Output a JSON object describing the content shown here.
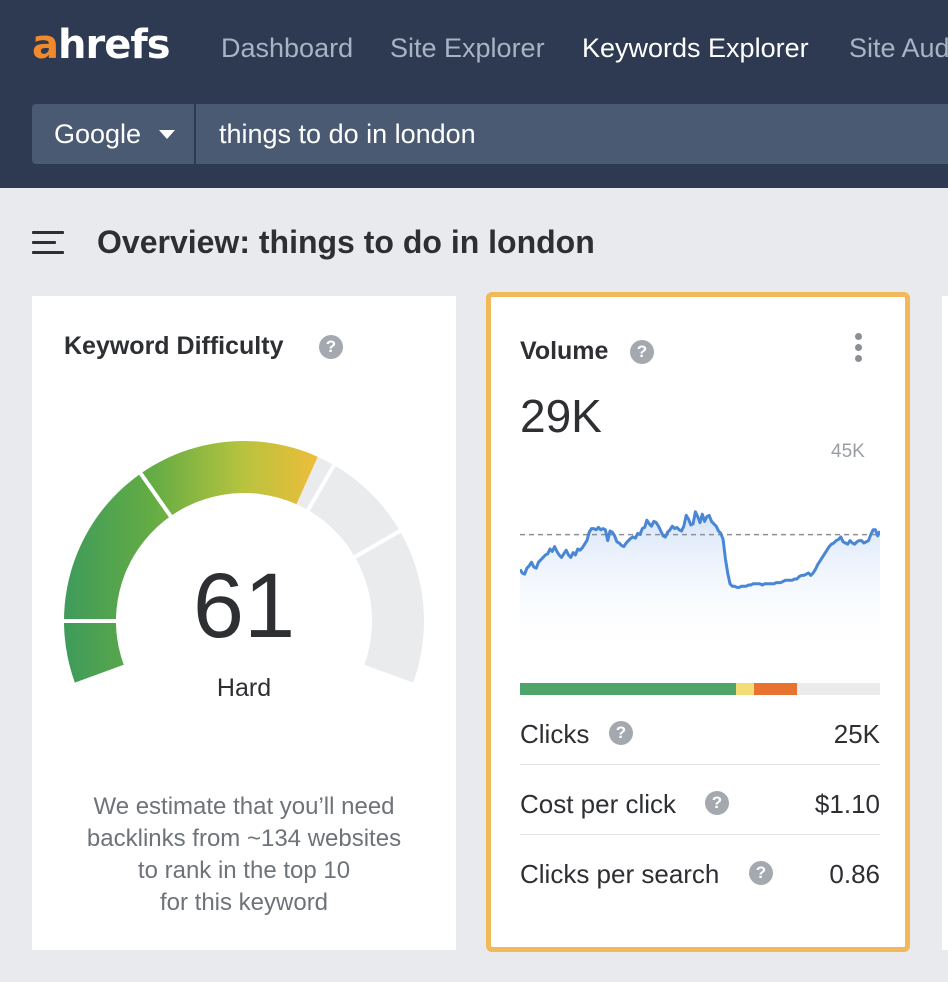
{
  "app": {
    "logo_first": "a",
    "logo_rest": "hrefs",
    "brand_color": "#f18a2c"
  },
  "nav": {
    "items": [
      {
        "label": "Dashboard",
        "active": false
      },
      {
        "label": "Site Explorer",
        "active": false
      },
      {
        "label": "Keywords Explorer",
        "active": true
      },
      {
        "label": "Site Aud",
        "active": false
      }
    ]
  },
  "search": {
    "engine": "Google",
    "query": "things to do in london"
  },
  "page": {
    "title": "Overview: things to do in london"
  },
  "icons": {
    "menu": "hamburger-menu-icon",
    "help": "question-mark-icon",
    "more": "vertical-dots-icon",
    "dropdown": "caret-down-icon",
    "help_glyph": "?"
  },
  "keyword_difficulty": {
    "title": "Keyword Difficulty",
    "value": "61",
    "score": 61,
    "max": 100,
    "label": "Hard",
    "description_lines": [
      "We estimate that you’ll need",
      "backlinks from ~134 websites",
      "to rank in the top 10",
      "for this keyword"
    ],
    "segment_colors": [
      "#3e9b5b",
      "#62ab44",
      "#b5c23e",
      "#e9bd3b",
      "#eaebed"
    ]
  },
  "volume": {
    "title": "Volume",
    "value": "29K",
    "chart_ymax_label": "45K",
    "chart_color": "#4a86d6",
    "trend": [
      0.63,
      0.6,
      0.59,
      0.64,
      0.66,
      0.69,
      0.65,
      0.64,
      0.69,
      0.71,
      0.73,
      0.75,
      0.76,
      0.8,
      0.78,
      0.82,
      0.78,
      0.75,
      0.73,
      0.76,
      0.79,
      0.75,
      0.73,
      0.77,
      0.75,
      0.8,
      0.79,
      0.81,
      0.84,
      0.87,
      0.94,
      0.97,
      0.97,
      0.96,
      0.98,
      0.96,
      0.97,
      0.96,
      0.87,
      0.95,
      0.94,
      0.91,
      0.86,
      0.85,
      0.83,
      0.82,
      0.85,
      0.87,
      0.89,
      0.9,
      0.89,
      0.93,
      0.92,
      0.97,
      0.98,
      1.04,
      1.01,
      0.99,
      1.03,
      1.02,
      0.99,
      0.95,
      0.91,
      0.9,
      0.94,
      0.96,
      0.99,
      0.97,
      0.98,
      0.96,
      0.95,
      0.99,
      1.08,
      1.05,
      1.0,
      1.01,
      1.11,
      1.07,
      1.02,
      1.09,
      1.03,
      1.07,
      1.08,
      1.03,
      1.01,
      0.99,
      0.95,
      0.93,
      0.88,
      0.72,
      0.6,
      0.51,
      0.49,
      0.49,
      0.48,
      0.48,
      0.49,
      0.49,
      0.49,
      0.5,
      0.5,
      0.51,
      0.51,
      0.51,
      0.51,
      0.5,
      0.51,
      0.51,
      0.51,
      0.51,
      0.51,
      0.52,
      0.52,
      0.52,
      0.53,
      0.54,
      0.54,
      0.54,
      0.54,
      0.55,
      0.55,
      0.57,
      0.58,
      0.58,
      0.59,
      0.6,
      0.58,
      0.6,
      0.63,
      0.67,
      0.7,
      0.73,
      0.76,
      0.79,
      0.82,
      0.84,
      0.85,
      0.87,
      0.88,
      0.9,
      0.86,
      0.85,
      0.84,
      0.87,
      0.85,
      0.84,
      0.86,
      0.87,
      0.87,
      0.85,
      0.86,
      0.87,
      0.92,
      0.96,
      0.96,
      0.91,
      0.95
    ],
    "trend_reference": 0.92,
    "intent_segments": [
      {
        "fraction": 0.6,
        "color": "#4fa46a"
      },
      {
        "fraction": 0.05,
        "color": "#f4dd74"
      },
      {
        "fraction": 0.12,
        "color": "#e8722f"
      },
      {
        "fraction": 0.23,
        "color": "#ebebeb"
      }
    ],
    "metrics": [
      {
        "label": "Clicks",
        "value": "25K"
      },
      {
        "label": "Cost per click",
        "value": "$1.10"
      },
      {
        "label": "Clicks per search",
        "value": "0.86"
      }
    ],
    "highlight_color": "#f2b95b"
  }
}
